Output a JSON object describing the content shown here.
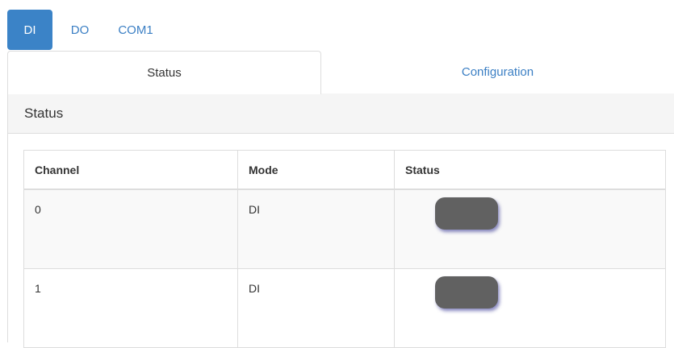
{
  "pills": [
    {
      "label": "DI",
      "active": true
    },
    {
      "label": "DO",
      "active": false
    },
    {
      "label": "COM1",
      "active": false
    }
  ],
  "tabs": {
    "status": "Status",
    "configuration": "Configuration"
  },
  "panel": {
    "title": "Status"
  },
  "table": {
    "headers": [
      "Channel",
      "Mode",
      "Status"
    ],
    "rows": [
      {
        "channel": "0",
        "mode": "DI",
        "status": "off"
      },
      {
        "channel": "1",
        "mode": "DI",
        "status": "off"
      }
    ]
  },
  "colors": {
    "accent": "#3b83c7",
    "link": "#3b7fc4",
    "toggle_off": "#616161"
  }
}
